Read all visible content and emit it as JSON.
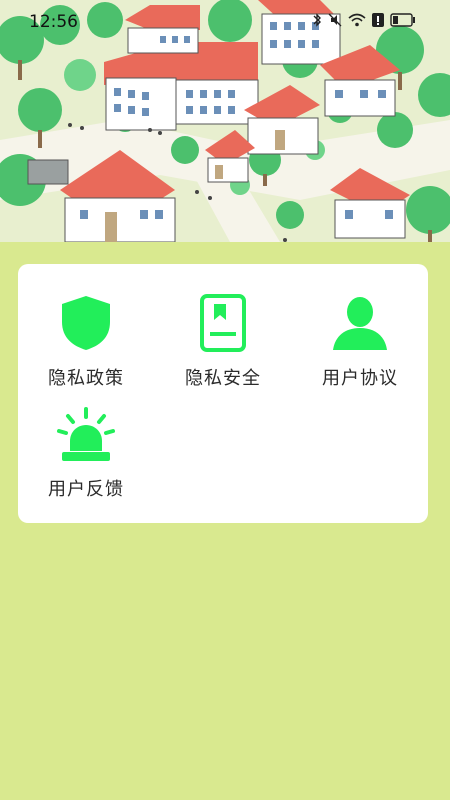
{
  "status_bar": {
    "time": "12:56"
  },
  "hero": {
    "description_icon": "village-illustration"
  },
  "menu": {
    "items": [
      {
        "label": "隐私政策",
        "icon": "shield-icon"
      },
      {
        "label": "隐私安全",
        "icon": "book-icon"
      },
      {
        "label": "用户协议",
        "icon": "user-icon"
      },
      {
        "label": "用户反馈",
        "icon": "alarm-light-icon"
      }
    ]
  },
  "colors": {
    "background": "#d9e98f",
    "accent_green": "#22ee5a",
    "card": "#ffffff",
    "roof": "#e96a5a"
  }
}
